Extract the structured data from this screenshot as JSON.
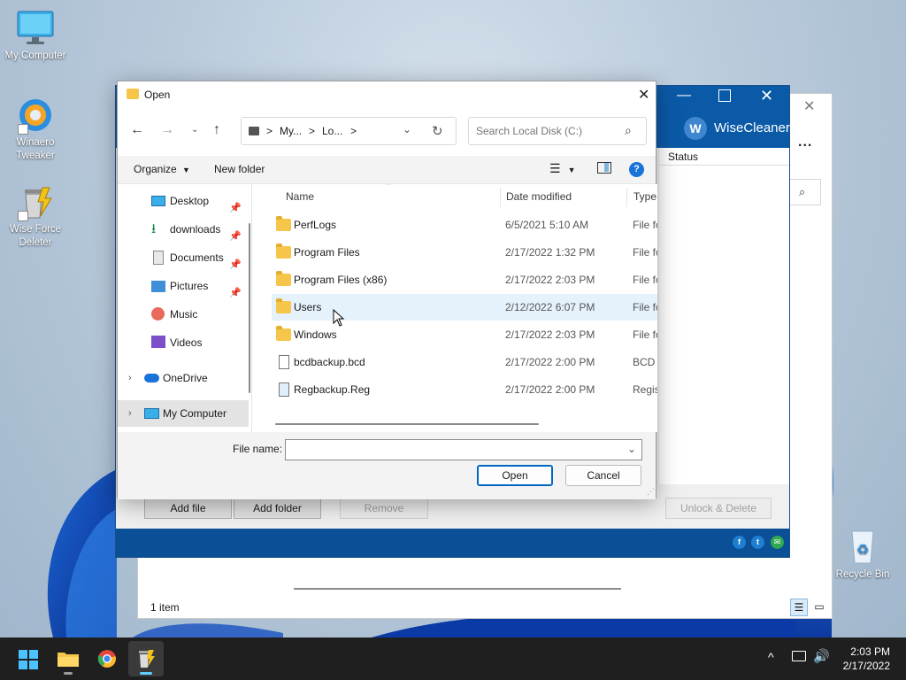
{
  "desktop": {
    "icons": [
      {
        "label": "My Computer"
      },
      {
        "label": "Winaero Tweaker"
      },
      {
        "label": "Wise Force Deleter"
      },
      {
        "label": "Recycle Bin"
      }
    ]
  },
  "wisecleaner": {
    "brand": "WiseCleaner",
    "status_col": "Status",
    "buttons": {
      "add_file": "Add file",
      "add_folder": "Add folder",
      "remove": "Remove",
      "unlock_delete": "Unlock & Delete"
    },
    "status_bar": "1 item",
    "more": "..."
  },
  "dialog": {
    "title": "Open",
    "address": {
      "seg1": "My...",
      "seg2": "Lo...",
      "sep": ">"
    },
    "search_placeholder": "Search Local Disk (C:)",
    "toolbar": {
      "organize": "Organize",
      "new_folder": "New folder"
    },
    "nav": [
      {
        "label": "Desktop"
      },
      {
        "label": "downloads"
      },
      {
        "label": "Documents"
      },
      {
        "label": "Pictures"
      },
      {
        "label": "Music"
      },
      {
        "label": "Videos"
      },
      {
        "label": "OneDrive"
      },
      {
        "label": "My Computer"
      }
    ],
    "columns": {
      "name": "Name",
      "date": "Date modified",
      "type": "Type"
    },
    "files": [
      {
        "name": "PerfLogs",
        "date": "6/5/2021 5:10 AM",
        "type": "File fo"
      },
      {
        "name": "Program Files",
        "date": "2/17/2022 1:32 PM",
        "type": "File fo"
      },
      {
        "name": "Program Files (x86)",
        "date": "2/17/2022 2:03 PM",
        "type": "File fo"
      },
      {
        "name": "Users",
        "date": "2/12/2022 6:07 PM",
        "type": "File fo"
      },
      {
        "name": "Windows",
        "date": "2/17/2022 2:03 PM",
        "type": "File fo"
      },
      {
        "name": "bcdbackup.bcd",
        "date": "2/17/2022 2:00 PM",
        "type": "BCD I"
      },
      {
        "name": "Regbackup.Reg",
        "date": "2/17/2022 2:00 PM",
        "type": "Regis"
      }
    ],
    "file_name_label": "File name:",
    "file_name_value": "",
    "open_label": "Open",
    "cancel_label": "Cancel"
  },
  "taskbar": {
    "time": "2:03 PM",
    "date": "2/17/2022"
  },
  "colors": {
    "accent": "#0067c0",
    "wise_blue": "#0b5aa8",
    "taskbar": "#1f1f1f"
  }
}
